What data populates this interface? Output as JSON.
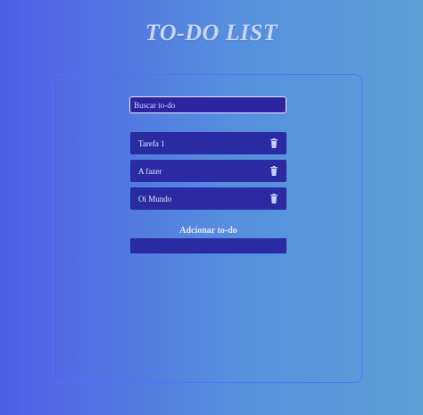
{
  "header": {
    "title": "TO-DO LIST"
  },
  "search": {
    "placeholder": "Buscar to-do"
  },
  "todos": [
    {
      "text": "Tarefa 1",
      "icon": "trash-icon"
    },
    {
      "text": "A fazer",
      "icon": "trash-icon"
    },
    {
      "text": "Oi Mundo",
      "icon": "trash-icon"
    }
  ],
  "add": {
    "label": "Adcionar to-do",
    "value": ""
  },
  "colors": {
    "background_start": "#4e5fe8",
    "background_end": "#59a0d8",
    "item_bg": "#2a2aa2",
    "title": "#c8d6ff"
  }
}
